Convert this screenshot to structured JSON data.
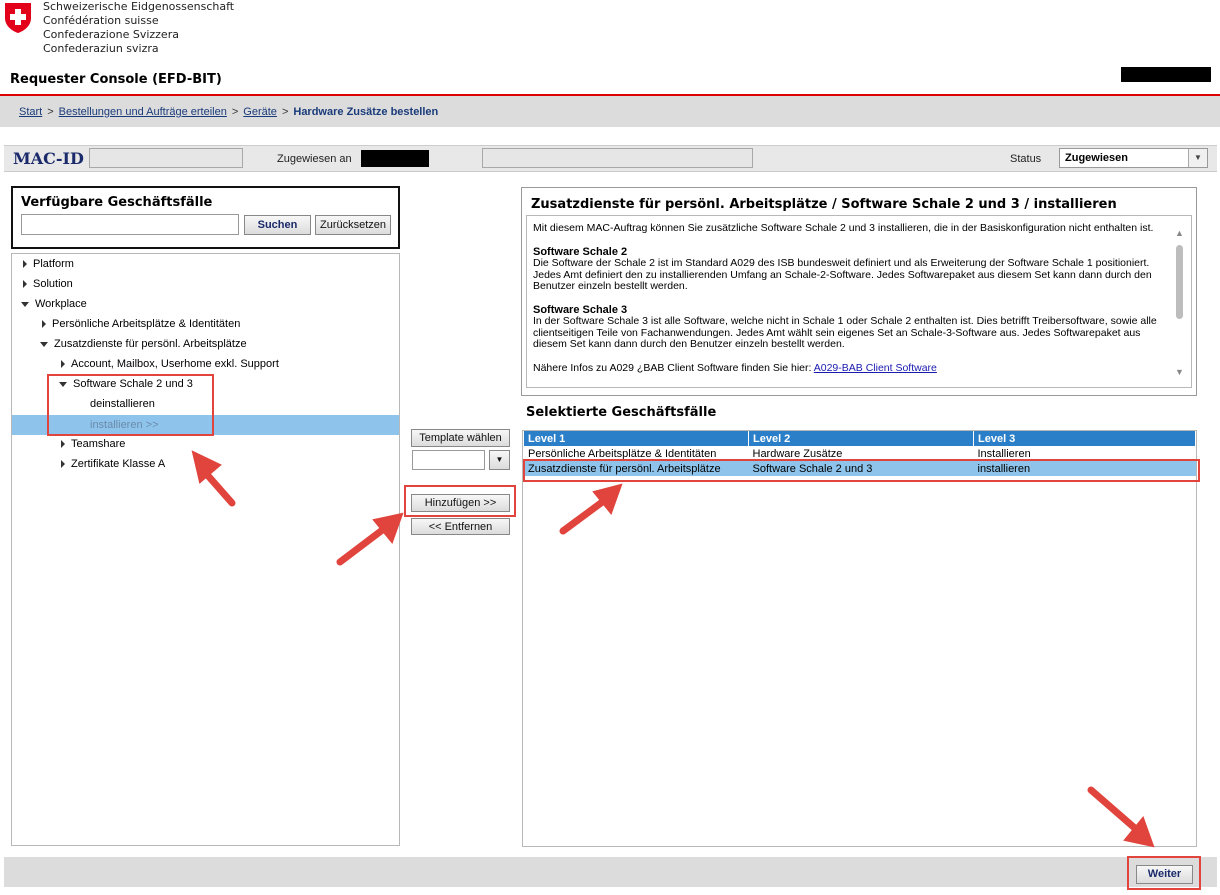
{
  "header": {
    "confederation_lines": [
      "Schweizerische Eidgenossenschaft",
      "Confédération suisse",
      "Confederazione Svizzera",
      "Confederaziun svizra"
    ],
    "app_title": "Requester Console (EFD-BIT)"
  },
  "breadcrumb": {
    "items": [
      "Start",
      "Bestellungen und Aufträge erteilen",
      "Geräte"
    ],
    "current": "Hardware Zusätze bestellen",
    "separator": ">"
  },
  "mac_bar": {
    "label": "MAC-ID",
    "assigned_label": "Zugewiesen an",
    "status_label": "Status",
    "status_value": "Zugewiesen"
  },
  "left_panel": {
    "title": "Verfügbare Geschäftsfälle",
    "search_placeholder": "",
    "search_button": "Suchen",
    "reset_button": "Zurücksetzen",
    "tree": [
      {
        "label": "Platform",
        "state": "collapsed",
        "level": 0
      },
      {
        "label": "Solution",
        "state": "collapsed",
        "level": 0
      },
      {
        "label": "Workplace",
        "state": "expanded",
        "level": 0
      },
      {
        "label": "Persönliche Arbeitsplätze & Identitäten",
        "state": "collapsed",
        "level": 1
      },
      {
        "label": "Zusatzdienste für persönl. Arbeitsplätze",
        "state": "expanded",
        "level": 1
      },
      {
        "label": "Account, Mailbox, Userhome exkl. Support",
        "state": "collapsed",
        "level": 2
      },
      {
        "label": "Software Schale 2 und 3",
        "state": "expanded",
        "level": 2
      },
      {
        "label": "deinstallieren",
        "state": "leaf",
        "level": 3
      },
      {
        "label": "installieren >>",
        "state": "leaf-selected",
        "level": 3
      },
      {
        "label": "Teamshare",
        "state": "collapsed",
        "level": 2
      },
      {
        "label": "Zertifikate Klasse A",
        "state": "collapsed",
        "level": 2
      }
    ]
  },
  "middle": {
    "template_button": "Template wählen",
    "add_button": "Hinzufügen >>",
    "remove_button": "<< Entfernen"
  },
  "description": {
    "title": "Zusatzdienste für persönl. Arbeitsplätze / Software Schale 2 und 3 / installieren",
    "intro": "Mit diesem MAC-Auftrag können Sie zusätzliche Software Schale 2 und 3 installieren, die in der Basiskonfiguration nicht enthalten ist.",
    "s2_title": "Software Schale 2",
    "s2_text": "Die Software der Schale 2 ist im Standard A029 des ISB bundesweit definiert und als Erweiterung der Software Schale 1 positioniert. Jedes Amt definiert den zu installierenden Umfang an Schale-2-Software. Jedes Softwarepaket aus diesem Set kann dann durch den Benutzer einzeln bestellt werden.",
    "s3_title": "Software Schale 3",
    "s3_text": "In der Software Schale 3 ist alle Software, welche nicht in Schale 1 oder Schale 2 enthalten ist. Dies betrifft Treibersoftware, sowie alle clientseitigen Teile von Fachanwendungen. Jedes Amt wählt sein eigenes Set an Schale-3-Software aus. Jedes Softwarepaket aus diesem Set kann dann durch den Benutzer einzeln bestellt werden.",
    "more_info_text": "Nähere Infos zu A029 ¿BAB Client Software finden Sie hier:",
    "more_info_link": "A029-BAB Client Software"
  },
  "selected": {
    "title": "Selektierte Geschäftsfälle",
    "columns": [
      "Level 1",
      "Level 2",
      "Level 3"
    ],
    "rows": [
      [
        "Persönliche Arbeitsplätze & Identitäten",
        "Hardware Zusätze",
        "Installieren"
      ],
      [
        "Zusatzdienste für persönl. Arbeitsplätze",
        "Software Schale 2 und 3",
        "installieren"
      ]
    ]
  },
  "footer": {
    "next_button": "Weiter"
  },
  "colors": {
    "accent_red": "#e0443c",
    "brand_red": "#dd0000",
    "table_header_blue": "#2a7fc8",
    "selection_blue": "#8ec4ec"
  }
}
